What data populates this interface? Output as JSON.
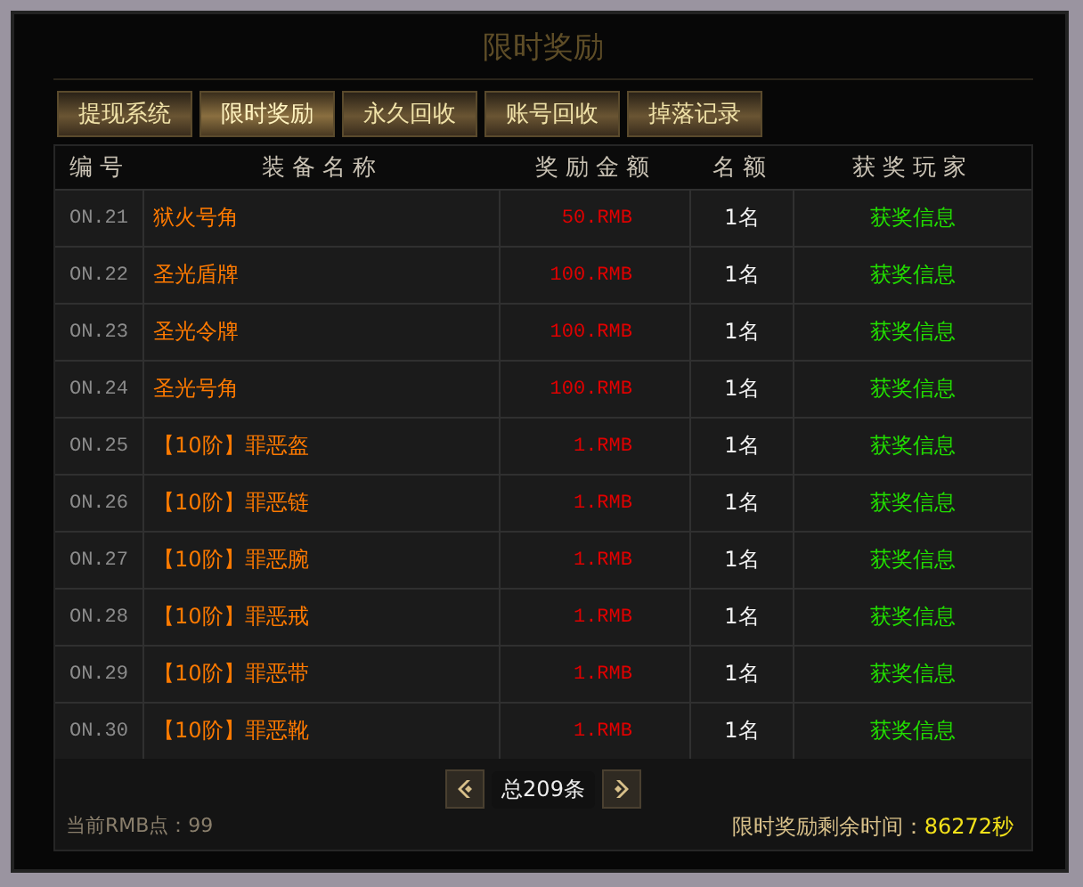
{
  "window": {
    "title": "限时奖励"
  },
  "tabs": [
    {
      "label": "提现系统",
      "selected": false
    },
    {
      "label": "限时奖励",
      "selected": true
    },
    {
      "label": "永久回收",
      "selected": false
    },
    {
      "label": "账号回收",
      "selected": false
    },
    {
      "label": "掉落记录",
      "selected": false
    }
  ],
  "table": {
    "columns": [
      "编号",
      "装备名称",
      "奖励金额",
      "名额",
      "获奖玩家"
    ],
    "rows": [
      {
        "number": "ON.21",
        "item": "狱火号角",
        "amount": "50.RMB",
        "quota": "1名",
        "winner": "获奖信息"
      },
      {
        "number": "ON.22",
        "item": "圣光盾牌",
        "amount": "100.RMB",
        "quota": "1名",
        "winner": "获奖信息"
      },
      {
        "number": "ON.23",
        "item": "圣光令牌",
        "amount": "100.RMB",
        "quota": "1名",
        "winner": "获奖信息"
      },
      {
        "number": "ON.24",
        "item": "圣光号角",
        "amount": "100.RMB",
        "quota": "1名",
        "winner": "获奖信息"
      },
      {
        "number": "ON.25",
        "item": "【10阶】罪恶盔",
        "amount": "1.RMB",
        "quota": "1名",
        "winner": "获奖信息"
      },
      {
        "number": "ON.26",
        "item": "【10阶】罪恶链",
        "amount": "1.RMB",
        "quota": "1名",
        "winner": "获奖信息"
      },
      {
        "number": "ON.27",
        "item": "【10阶】罪恶腕",
        "amount": "1.RMB",
        "quota": "1名",
        "winner": "获奖信息"
      },
      {
        "number": "ON.28",
        "item": "【10阶】罪恶戒",
        "amount": "1.RMB",
        "quota": "1名",
        "winner": "获奖信息"
      },
      {
        "number": "ON.29",
        "item": "【10阶】罪恶带",
        "amount": "1.RMB",
        "quota": "1名",
        "winner": "获奖信息"
      },
      {
        "number": "ON.30",
        "item": "【10阶】罪恶靴",
        "amount": "1.RMB",
        "quota": "1名",
        "winner": "获奖信息"
      }
    ]
  },
  "pager": {
    "total": "总209条"
  },
  "footer": {
    "points_label": "当前RMB点：",
    "points": "99",
    "timer_label": "限时奖励剩余时间：",
    "timer": "86272秒"
  }
}
